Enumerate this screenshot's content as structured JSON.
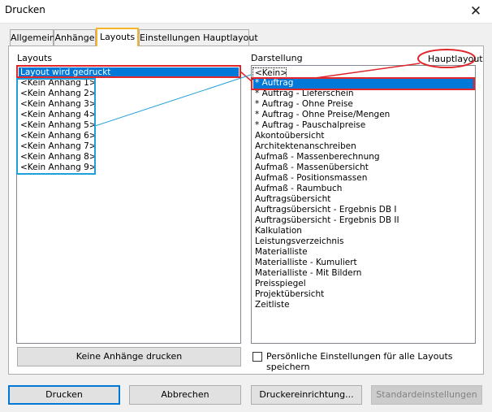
{
  "window": {
    "title": "Drucken",
    "close_glyph": "✕"
  },
  "tabs": [
    {
      "label": "Allgemein"
    },
    {
      "label": "Anhänge"
    },
    {
      "label": "Layouts"
    },
    {
      "label": "Einstellungen Hauptlayout"
    }
  ],
  "layouts": {
    "label": "Layouts",
    "items": [
      "Layout wird gedruckt",
      "<Kein Anhang 1>",
      "<Kein Anhang 2>",
      "<Kein Anhang 3>",
      "<Kein Anhang 4>",
      "<Kein Anhang 5>",
      "<Kein Anhang 6>",
      "<Kein Anhang 7>",
      "<Kein Anhang 8>",
      "<Kein Anhang 9>"
    ],
    "selected_index": 0
  },
  "darstellung": {
    "label": "Darstellung",
    "callout": "Hauptlayout",
    "items": [
      "<Kein>",
      "* Auftrag",
      "* Auftrag - Lieferschein",
      "* Auftrag - Ohne Preise",
      "* Auftrag - Ohne Preise/Mengen",
      "* Auftrag - Pauschalpreise",
      "Akontoübersicht",
      "Architektenanschreiben",
      "Aufmaß - Massenberechnung",
      "Aufmaß - Massenübersicht",
      "Aufmaß - Positionsmassen",
      "Aufmaß - Raumbuch",
      "Auftragsübersicht",
      "Auftragsübersicht - Ergebnis DB I",
      "Auftragsübersicht - Ergebnis DB II",
      "Kalkulation",
      "Leistungsverzeichnis",
      "Materialliste",
      "Materialliste - Kumuliert",
      "Materialliste - Mit Bildern",
      "Preisspiegel",
      "Projektübersicht",
      "Zeitliste"
    ],
    "selected_index": 1
  },
  "buttons": {
    "keine_anhaenge": "Keine Anhänge drucken",
    "drucken": "Drucken",
    "abbrechen": "Abbrechen",
    "druckereinrichtung": "Druckereinrichtung...",
    "standard": "Standardeinstellungen"
  },
  "checkbox": {
    "label": "Persönliche Einstellungen für alle Layouts speichern",
    "checked": false
  },
  "colors": {
    "selection": "#0078d7",
    "annotation_red": "#e0262b",
    "annotation_blue": "#1fa0dc",
    "tab_highlight": "#f7b52a"
  }
}
